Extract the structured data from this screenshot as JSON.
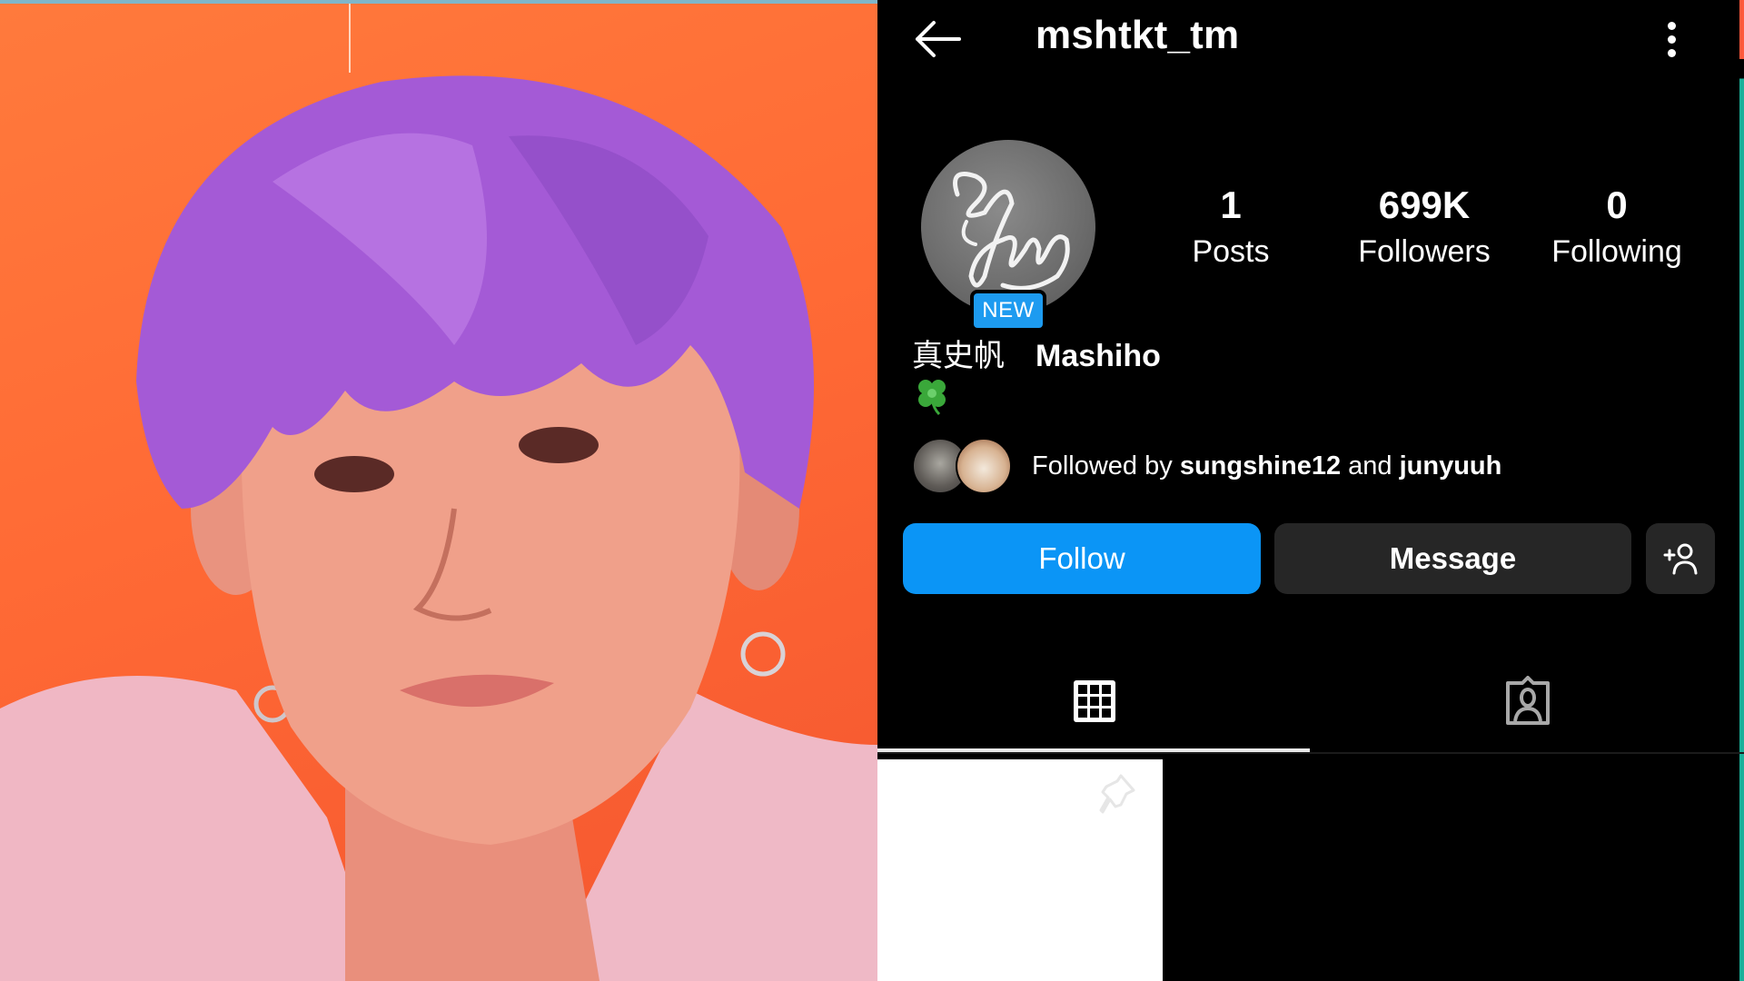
{
  "photo": {
    "description": "Portrait of a person with purple hair against an orange background",
    "background_color": "#ff6a35",
    "hair_color": "#a45ad6"
  },
  "header": {
    "back_icon": "arrow-left-icon",
    "username": "mshtkt_tm",
    "more_icon": "more-vertical-icon"
  },
  "profile": {
    "avatar_icon": "signature-avatar",
    "new_badge": "NEW",
    "stats": [
      {
        "value": "1",
        "label": "Posts"
      },
      {
        "value": "699K",
        "label": "Followers"
      },
      {
        "value": "0",
        "label": "Following"
      }
    ],
    "full_name_cjk": "真史帆",
    "full_name_latin": "Mashiho",
    "bio_emoji": "four-leaf-clover"
  },
  "followed_by": {
    "prefix": "Followed by ",
    "user1": "sungshine12",
    "conjunction": " and ",
    "user2": "junyuuh"
  },
  "actions": {
    "follow_label": "Follow",
    "message_label": "Message",
    "add_user_icon": "add-person-icon"
  },
  "colors": {
    "follow_blue": "#0b95f6",
    "badge_blue": "#1d9bf0",
    "button_dark": "#262626",
    "background": "#000000"
  },
  "tabs": [
    {
      "name": "posts-grid",
      "icon": "grid-icon",
      "active": true
    },
    {
      "name": "tagged",
      "icon": "tagged-person-icon",
      "active": false
    }
  ],
  "grid": {
    "post_count_visible": 1,
    "first_post_pinned": true
  }
}
